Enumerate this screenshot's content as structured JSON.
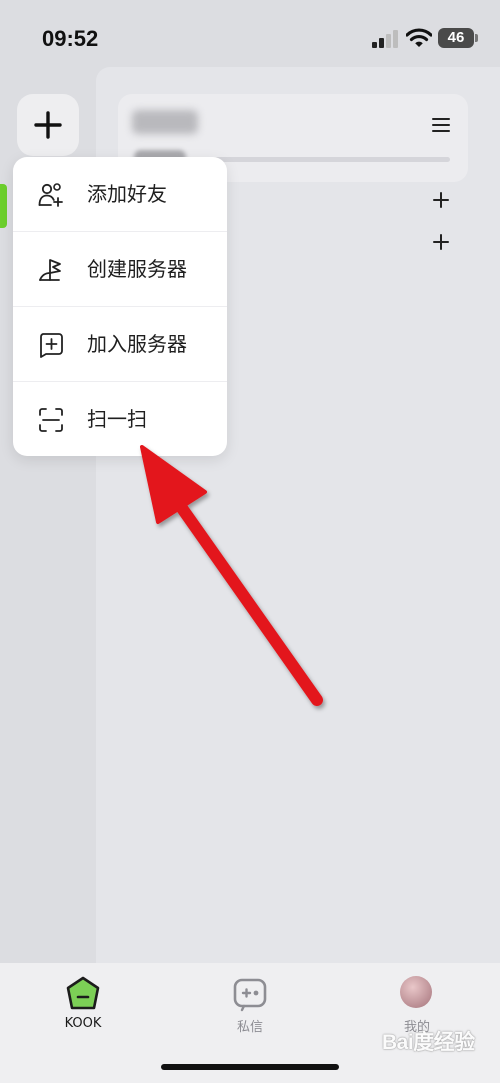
{
  "status_bar": {
    "time": "09:52",
    "battery": "46"
  },
  "popup_menu": {
    "items": [
      {
        "label": "添加好友",
        "icon": "add-friend-icon"
      },
      {
        "label": "创建服务器",
        "icon": "flag-icon"
      },
      {
        "label": "加入服务器",
        "icon": "plus-bubble-icon"
      },
      {
        "label": "扫一扫",
        "icon": "scan-icon"
      }
    ]
  },
  "tab_bar": {
    "tabs": [
      {
        "label": "KOOK",
        "icon": "kook-home-icon",
        "active": true
      },
      {
        "label": "私信",
        "icon": "gamepad-message-icon",
        "active": false
      },
      {
        "label": "我的",
        "icon": "avatar",
        "active": false
      }
    ]
  },
  "watermark": {
    "text": "Bai度经验"
  },
  "colors": {
    "accent_green": "#6ccf2c",
    "annotation_arrow": "#e3141b"
  }
}
